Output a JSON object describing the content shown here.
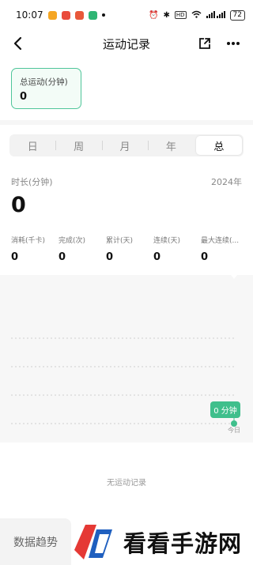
{
  "status_bar": {
    "time": "10:07",
    "battery": "72"
  },
  "header": {
    "title": "运动记录"
  },
  "total_card": {
    "label": "总运动(分钟)",
    "value": "0"
  },
  "tabs": [
    {
      "label": "日"
    },
    {
      "label": "周"
    },
    {
      "label": "月"
    },
    {
      "label": "年"
    },
    {
      "label": "总",
      "active": true
    }
  ],
  "summary": {
    "duration_label": "时长(分钟)",
    "year": "2024年",
    "duration_value": "0"
  },
  "stats": [
    {
      "label": "消耗(千卡)",
      "value": "0"
    },
    {
      "label": "完成(次)",
      "value": "0"
    },
    {
      "label": "累计(天)",
      "value": "0"
    },
    {
      "label": "连续(天)",
      "value": "0"
    },
    {
      "label": "最大连续(...",
      "value": "0"
    }
  ],
  "chart": {
    "tooltip": "0 分钟",
    "today_label": "今日",
    "accent": "#3fbf8c"
  },
  "chart_data": {
    "type": "line",
    "categories": [
      "今日"
    ],
    "values": [
      0
    ]
  },
  "empty_text": "无运动记录",
  "bottom_tab": {
    "label": "数据趋势"
  },
  "watermark": {
    "text": "看看手游网"
  }
}
